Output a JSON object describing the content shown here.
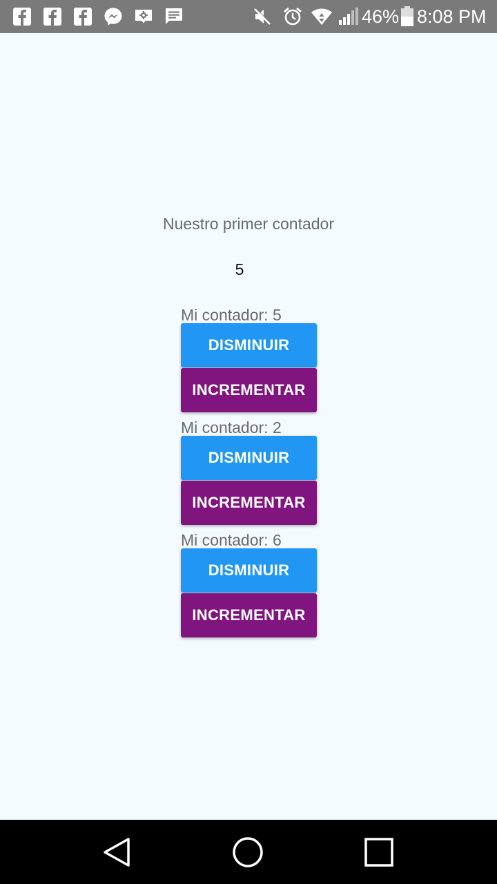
{
  "status_bar": {
    "battery_percent": "46%",
    "time": "8:08 PM",
    "notification_icons": [
      "facebook-icon",
      "facebook-icon",
      "facebook-icon",
      "messenger-icon",
      "photo-notification-icon",
      "message-icon"
    ],
    "system_icons": [
      "mute-icon",
      "alarm-icon",
      "wifi-icon",
      "signal-icon",
      "battery-icon"
    ]
  },
  "app": {
    "title": "Nuestro primer contador",
    "main_count": "5",
    "counters": [
      {
        "label": "Mi contador: 5",
        "decrement_label": "DISMINUIR",
        "increment_label": "INCREMENTAR"
      },
      {
        "label": "Mi contador: 2",
        "decrement_label": "DISMINUIR",
        "increment_label": "INCREMENTAR"
      },
      {
        "label": "Mi contador: 6",
        "decrement_label": "DISMINUIR",
        "increment_label": "INCREMENTAR"
      }
    ]
  },
  "colors": {
    "status_bar": "#7a7a7a",
    "background": "#f4fbff",
    "decrement_button": "#2196f3",
    "increment_button": "#80157f",
    "nav_bar": "#000000"
  },
  "nav_bar": {
    "icons": [
      "back-icon",
      "home-icon",
      "recents-icon"
    ]
  }
}
